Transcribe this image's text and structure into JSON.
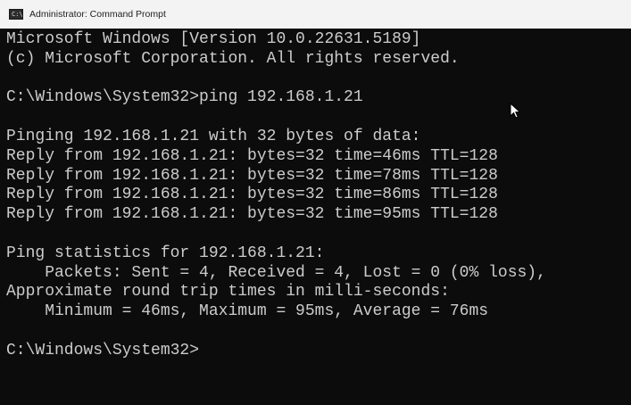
{
  "window": {
    "title": "Administrator: Command Prompt",
    "icon": "command-prompt-icon",
    "icon_glyph": "C:\\"
  },
  "console": {
    "lines": [
      "Microsoft Windows [Version 10.0.22631.5189]",
      "(c) Microsoft Corporation. All rights reserved.",
      "",
      "C:\\Windows\\System32>ping 192.168.1.21",
      "",
      "Pinging 192.168.1.21 with 32 bytes of data:",
      "Reply from 192.168.1.21: bytes=32 time=46ms TTL=128",
      "Reply from 192.168.1.21: bytes=32 time=78ms TTL=128",
      "Reply from 192.168.1.21: bytes=32 time=86ms TTL=128",
      "Reply from 192.168.1.21: bytes=32 time=95ms TTL=128",
      "",
      "Ping statistics for 192.168.1.21:",
      "    Packets: Sent = 4, Received = 4, Lost = 0 (0% loss),",
      "Approximate round trip times in milli-seconds:",
      "    Minimum = 46ms, Maximum = 95ms, Average = 76ms",
      "",
      "C:\\Windows\\System32>"
    ]
  },
  "colors": {
    "console_background": "#0c0c0c",
    "console_text": "#cccccc",
    "titlebar_background": "#f3f3f3"
  },
  "mouse_cursor": "arrow-cursor-icon"
}
